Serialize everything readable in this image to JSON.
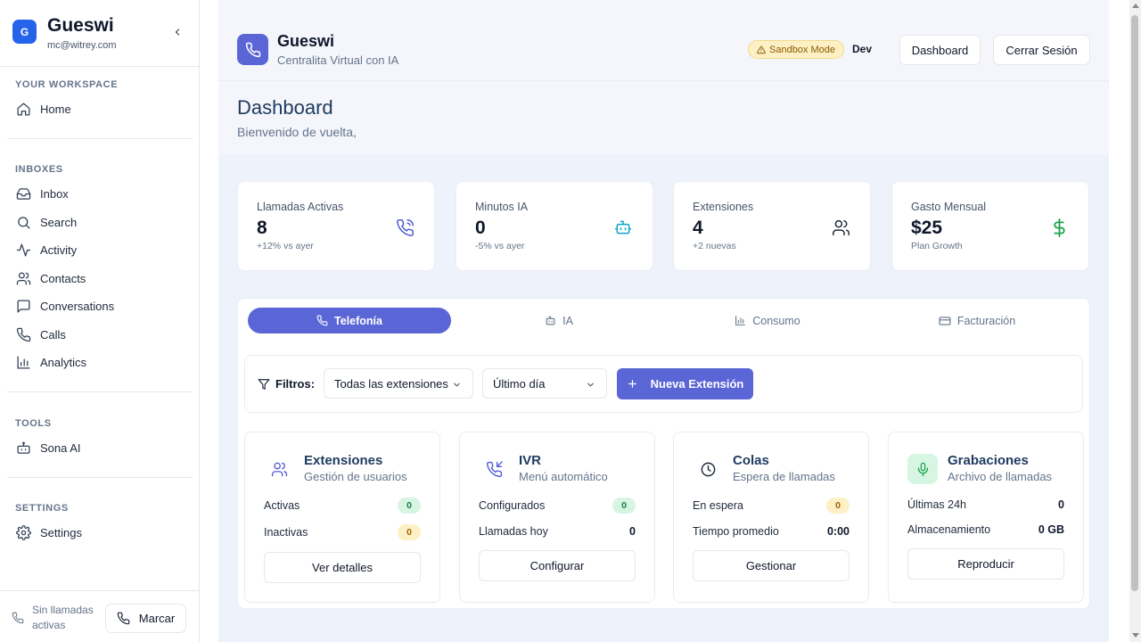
{
  "workspace": {
    "avatar": "G",
    "name": "Gueswi",
    "email": "mc@witrey.com"
  },
  "sidebar": {
    "sections": [
      {
        "title": "YOUR WORKSPACE",
        "items": [
          {
            "label": "Home",
            "icon": "home-icon"
          }
        ]
      },
      {
        "title": "INBOXES",
        "items": [
          {
            "label": "Inbox",
            "icon": "inbox-icon"
          },
          {
            "label": "Search",
            "icon": "search-icon"
          },
          {
            "label": "Activity",
            "icon": "activity-icon"
          },
          {
            "label": "Contacts",
            "icon": "users-icon"
          },
          {
            "label": "Conversations",
            "icon": "message-icon"
          },
          {
            "label": "Calls",
            "icon": "phone-icon"
          },
          {
            "label": "Analytics",
            "icon": "bar-chart-icon"
          }
        ]
      },
      {
        "title": "TOOLS",
        "items": [
          {
            "label": "Sona AI",
            "icon": "bot-icon"
          }
        ]
      },
      {
        "title": "SETTINGS",
        "items": [
          {
            "label": "Settings",
            "icon": "gear-icon"
          }
        ]
      }
    ],
    "footer": {
      "status": "Sin llamadas activas",
      "dial_label": "Marcar"
    }
  },
  "header": {
    "brand_name": "Gueswi",
    "brand_sub": "Centralita Virtual con IA",
    "sandbox_label": "Sandbox Mode",
    "env_label": "Dev",
    "dashboard_button": "Dashboard",
    "logout_button": "Cerrar Sesión"
  },
  "page": {
    "title": "Dashboard",
    "subtitle": "Bienvenido de vuelta,"
  },
  "stats": [
    {
      "label": "Llamadas Activas",
      "value": "8",
      "sub": "+12% vs ayer",
      "icon": "phone-call-icon",
      "color": "#4f5bd5"
    },
    {
      "label": "Minutos IA",
      "value": "0",
      "sub": "-5% vs ayer",
      "icon": "bot-icon",
      "color": "#0ea5c6"
    },
    {
      "label": "Extensiones",
      "value": "4",
      "sub": "+2 nuevas",
      "icon": "users-icon",
      "color": "#1e293b"
    },
    {
      "label": "Gasto Mensual",
      "value": "$25",
      "sub": "Plan Growth",
      "icon": "dollar-icon",
      "color": "#16a34a"
    }
  ],
  "tabs": [
    {
      "label": "Telefonía",
      "icon": "phone-icon",
      "active": true
    },
    {
      "label": "IA",
      "icon": "bot-icon",
      "active": false
    },
    {
      "label": "Consumo",
      "icon": "bar-chart-icon",
      "active": false
    },
    {
      "label": "Facturación",
      "icon": "credit-card-icon",
      "active": false
    }
  ],
  "filters": {
    "label": "Filtros:",
    "extension_select": "Todas las extensiones",
    "period_select": "Último día",
    "new_button": "Nueva Extensión"
  },
  "cards": [
    {
      "title": "Extensiones",
      "subtitle": "Gestión de usuarios",
      "icon": "users-icon",
      "rows": [
        {
          "label": "Activas",
          "value": "0",
          "style": "pill-green"
        },
        {
          "label": "Inactivas",
          "value": "0",
          "style": "pill-yellow"
        }
      ],
      "button": "Ver detalles"
    },
    {
      "title": "IVR",
      "subtitle": "Menú automático",
      "icon": "phone-incoming-icon",
      "rows": [
        {
          "label": "Configurados",
          "value": "0",
          "style": "pill-green"
        },
        {
          "label": "Llamadas hoy",
          "value": "0",
          "style": "plain"
        }
      ],
      "button": "Configurar"
    },
    {
      "title": "Colas",
      "subtitle": "Espera de llamadas",
      "icon": "clock-icon",
      "rows": [
        {
          "label": "En espera",
          "value": "0",
          "style": "pill-yellow"
        },
        {
          "label": "Tiempo promedio",
          "value": "0:00",
          "style": "plain"
        }
      ],
      "button": "Gestionar"
    },
    {
      "title": "Grabaciones",
      "subtitle": "Archivo de llamadas",
      "icon": "mic-icon",
      "rows": [
        {
          "label": "Últimas 24h",
          "value": "0",
          "style": "plain"
        },
        {
          "label": "Almacenamiento",
          "value": "0 GB",
          "style": "plain"
        }
      ],
      "button": "Reproducir"
    }
  ],
  "colors": {
    "accent": "#5b66d6",
    "page_bg": "#f4f6fb",
    "content_bg": "#eef2fb",
    "workspace_avatar": "#2563eb"
  }
}
